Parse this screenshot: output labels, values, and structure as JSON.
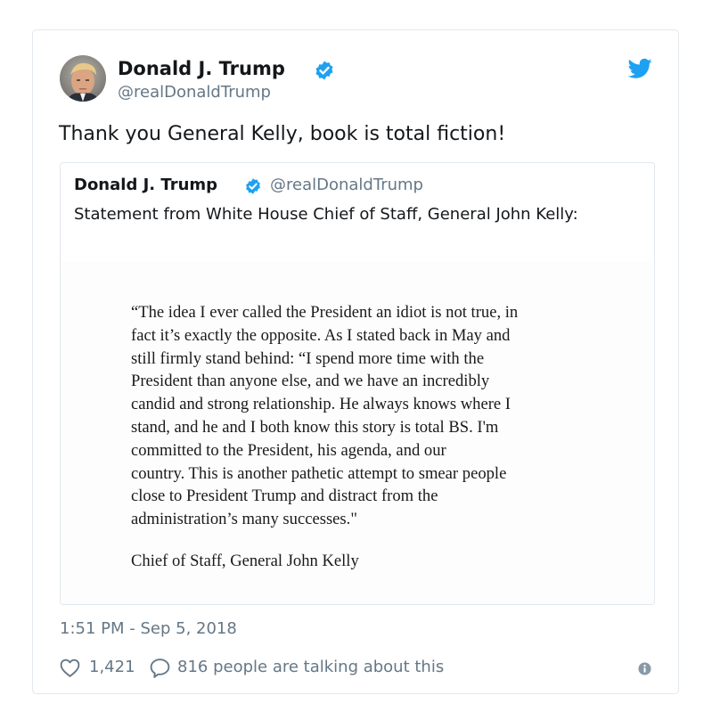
{
  "tweet": {
    "author_name": "Donald J. Trump",
    "author_handle": "@realDonaldTrump",
    "text": "Thank you General Kelly, book is total fiction!",
    "timestamp": "1:51 PM - Sep 5, 2018",
    "likes": "1,421",
    "replies_text": "816 people are talking about this"
  },
  "quoted": {
    "author_name": "Donald J. Trump",
    "author_handle": "@realDonaldTrump",
    "text": "Statement from White House Chief of Staff, General John Kelly:",
    "statement_lines": [
      "“The idea I ever called the President an idiot is not true, in",
      "fact it’s exactly the opposite. As I stated back in May and",
      "still firmly stand behind: “I spend more time with the",
      "President than anyone else, and we have an incredibly",
      "candid and strong relationship. He always knows where I",
      "stand, and he and I both know this story is total BS. I'm",
      "committed to the President, his agenda, and our",
      "country. This is another pathetic attempt to smear people",
      "close to President Trump and distract from the",
      "administration’s many successes.\""
    ],
    "statement_signature": "Chief of Staff, General John Kelly"
  },
  "icons": {
    "verified": "verified-badge-icon",
    "brand": "twitter-bird-icon",
    "like": "heart-icon",
    "reply": "speech-bubble-icon",
    "info": "info-icon"
  },
  "colors": {
    "brand_blue": "#1da1f2",
    "secondary_text": "#657786",
    "border": "#e1e8ed"
  }
}
